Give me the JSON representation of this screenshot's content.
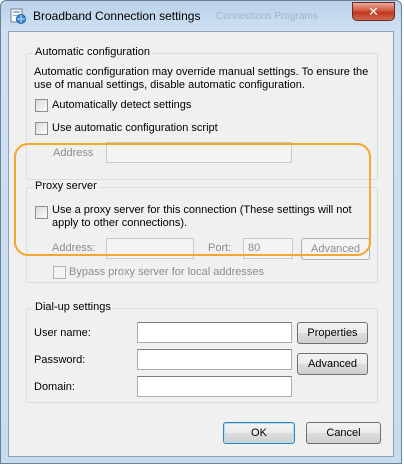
{
  "window": {
    "title": "Broadband Connection settings",
    "ghost_title": "Connections  Programs",
    "close_glyph": "✕"
  },
  "automatic_config": {
    "heading": "Automatic configuration",
    "description_line1": "Automatic configuration may override manual settings.  To ensure the",
    "description_line2": "use of manual settings, disable automatic configuration.",
    "auto_detect_label": "Automatically detect settings",
    "auto_script_label": "Use automatic configuration script",
    "address_label": "Address",
    "address_value": ""
  },
  "proxy": {
    "heading": "Proxy server",
    "use_proxy_line1": "Use a proxy server for this connection (These settings will not",
    "use_proxy_line2": "apply to other connections).",
    "address_label": "Address:",
    "address_value": "",
    "port_label": "Port:",
    "port_value": "80",
    "advanced_label": "Advanced",
    "bypass_label": "Bypass proxy server for local addresses"
  },
  "dialup": {
    "heading": "Dial-up settings",
    "username_label": "User name:",
    "password_label": "Password:",
    "domain_label": "Domain:",
    "properties_label": "Properties",
    "advanced_label": "Advanced"
  },
  "footer": {
    "ok_label": "OK",
    "cancel_label": "Cancel"
  },
  "colors": {
    "highlight": "#f5a630",
    "title_bar": "#b9d1ea",
    "close_button": "#c0361f"
  },
  "icons": {
    "title": "network-settings-icon",
    "close": "close-icon"
  }
}
